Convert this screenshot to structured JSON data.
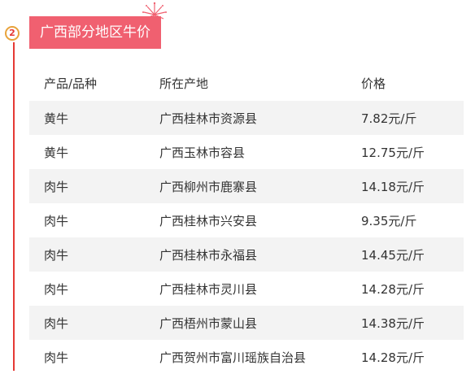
{
  "section": {
    "step_number": "2",
    "title": "广西部分地区牛价"
  },
  "table": {
    "headers": [
      "产品/品种",
      "所在产地",
      "价格"
    ],
    "rows": [
      [
        "黄牛",
        "广西桂林市资源县",
        "7.82元/斤"
      ],
      [
        "黄牛",
        "广西玉林市容县",
        "12.75元/斤"
      ],
      [
        "肉牛",
        "广西柳州市鹿寨县",
        "14.18元/斤"
      ],
      [
        "肉牛",
        "广西桂林市兴安县",
        "9.35元/斤"
      ],
      [
        "肉牛",
        "广西桂林市永福县",
        "14.45元/斤"
      ],
      [
        "肉牛",
        "广西桂林市灵川县",
        "14.28元/斤"
      ],
      [
        "肉牛",
        "广西梧州市蒙山县",
        "14.38元/斤"
      ],
      [
        "肉牛",
        "广西贺州市富川瑶族自治县",
        "14.28元/斤"
      ]
    ]
  },
  "colors": {
    "accent": "#f06070",
    "timeline": "#e53935",
    "badge_border": "#e8a33b",
    "row_stripe": "#f3f3f3"
  },
  "icons": {
    "firework": "firework-icon"
  }
}
